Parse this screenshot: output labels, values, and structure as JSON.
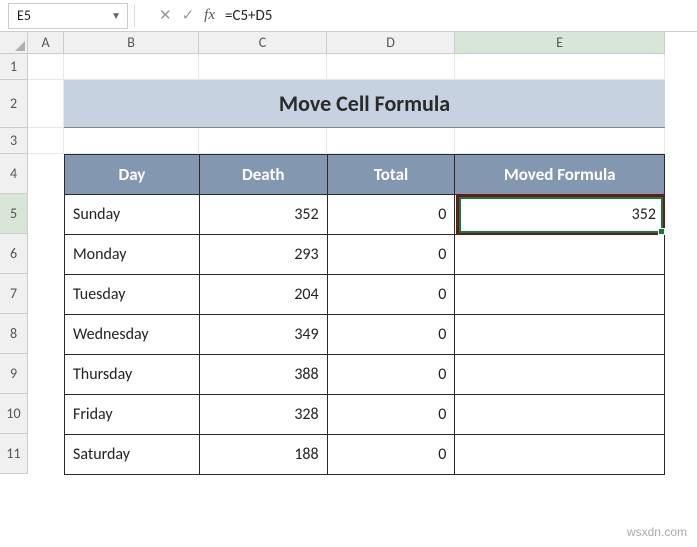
{
  "formula_bar": {
    "name_box": "E5",
    "formula": "=C5+D5"
  },
  "columns": [
    "A",
    "B",
    "C",
    "D",
    "E"
  ],
  "rows": [
    "1",
    "2",
    "3",
    "4",
    "5",
    "6",
    "7",
    "8",
    "9",
    "10",
    "11"
  ],
  "active_col": "E",
  "active_row": "5",
  "title": "Move Cell Formula",
  "headers": {
    "day": "Day",
    "death": "Death",
    "total": "Total",
    "moved": "Moved Formula"
  },
  "chart_data": {
    "type": "table",
    "title": "Move Cell Formula",
    "columns": [
      "Day",
      "Death",
      "Total",
      "Moved Formula"
    ],
    "rows": [
      {
        "day": "Sunday",
        "death": 352,
        "total": 0,
        "moved": 352
      },
      {
        "day": "Monday",
        "death": 293,
        "total": 0,
        "moved": ""
      },
      {
        "day": "Tuesday",
        "death": 204,
        "total": 0,
        "moved": ""
      },
      {
        "day": "Wednesday",
        "death": 349,
        "total": 0,
        "moved": ""
      },
      {
        "day": "Thursday",
        "death": 388,
        "total": 0,
        "moved": ""
      },
      {
        "day": "Friday",
        "death": 328,
        "total": 0,
        "moved": ""
      },
      {
        "day": "Saturday",
        "death": 188,
        "total": 0,
        "moved": ""
      }
    ]
  },
  "watermark": "wsxdn.com"
}
